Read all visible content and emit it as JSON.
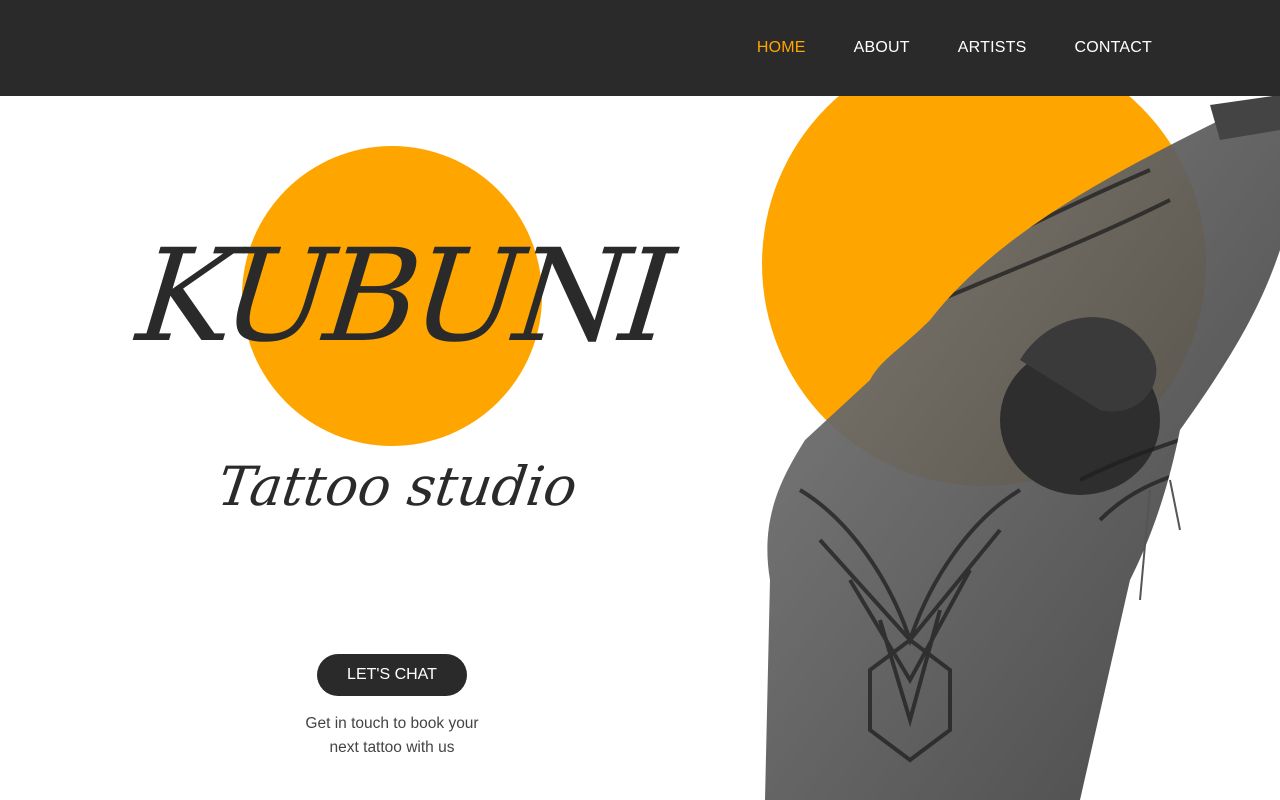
{
  "nav": {
    "items": [
      {
        "label": "HOME",
        "active": true
      },
      {
        "label": "ABOUT",
        "active": false
      },
      {
        "label": "ARTISTS",
        "active": false
      },
      {
        "label": "CONTACT",
        "active": false
      }
    ]
  },
  "brand": {
    "name": "KUBUNI",
    "tagline": "Tattoo studio"
  },
  "cta": {
    "button_label": "LET'S CHAT",
    "subtext_line1": "Get in touch to book your",
    "subtext_line2": "next tattoo with us"
  },
  "hero_image": {
    "subject": "tattooed-back-figure-icon"
  },
  "colors": {
    "accent": "#ffa500",
    "dark": "#2a2a2a",
    "background": "#ffffff"
  }
}
